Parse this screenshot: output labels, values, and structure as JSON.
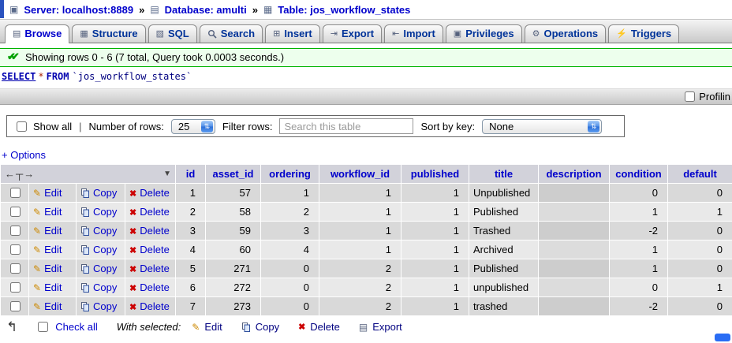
{
  "breadcrumb": {
    "server": "Server: localhost:8889",
    "database": "Database: amulti",
    "table": "Table: jos_workflow_states",
    "separator": "»"
  },
  "tabs": [
    {
      "label": "Browse",
      "icon": "browse-icon",
      "active": true
    },
    {
      "label": "Structure",
      "icon": "structure-icon",
      "active": false
    },
    {
      "label": "SQL",
      "icon": "sql-icon",
      "active": false
    },
    {
      "label": "Search",
      "icon": "search-icon",
      "active": false
    },
    {
      "label": "Insert",
      "icon": "insert-icon",
      "active": false
    },
    {
      "label": "Export",
      "icon": "export-icon",
      "active": false
    },
    {
      "label": "Import",
      "icon": "import-icon",
      "active": false
    },
    {
      "label": "Privileges",
      "icon": "privileges-icon",
      "active": false
    },
    {
      "label": "Operations",
      "icon": "operations-icon",
      "active": false
    },
    {
      "label": "Triggers",
      "icon": "triggers-icon",
      "active": false
    }
  ],
  "status_message": "Showing rows 0 - 6 (7 total, Query took 0.0003 seconds.)",
  "sql": {
    "keyword_select": "SELECT",
    "star": "*",
    "keyword_from": "FROM",
    "table_name": "`jos_workflow_states`"
  },
  "profiling_label": "Profilin",
  "controls": {
    "show_all_label": "Show all",
    "separator": "|",
    "number_of_rows_label": "Number of rows:",
    "number_of_rows_value": "25",
    "filter_label": "Filter rows:",
    "filter_placeholder": "Search this table",
    "sort_label": "Sort by key:",
    "sort_value": "None"
  },
  "options_label": "+ Options",
  "grid": {
    "column_headers": [
      "id",
      "asset_id",
      "ordering",
      "workflow_id",
      "published",
      "title",
      "description",
      "condition",
      "default"
    ],
    "row_actions": {
      "edit": "Edit",
      "copy": "Copy",
      "delete": "Delete"
    },
    "rows": [
      {
        "cells": [
          "1",
          "57",
          "1",
          "1",
          "1",
          "Unpublished",
          "",
          "0",
          "0"
        ]
      },
      {
        "cells": [
          "2",
          "58",
          "2",
          "1",
          "1",
          "Published",
          "",
          "1",
          "1"
        ]
      },
      {
        "cells": [
          "3",
          "59",
          "3",
          "1",
          "1",
          "Trashed",
          "",
          "-2",
          "0"
        ]
      },
      {
        "cells": [
          "4",
          "60",
          "4",
          "1",
          "1",
          "Archived",
          "",
          "1",
          "0"
        ]
      },
      {
        "cells": [
          "5",
          "271",
          "0",
          "2",
          "1",
          "Published",
          "",
          "1",
          "0"
        ]
      },
      {
        "cells": [
          "6",
          "272",
          "0",
          "2",
          "1",
          "unpublished",
          "",
          "0",
          "1"
        ]
      },
      {
        "cells": [
          "7",
          "273",
          "0",
          "2",
          "1",
          "trashed",
          "",
          "-2",
          "0"
        ]
      }
    ]
  },
  "footer": {
    "check_all_label": "Check all",
    "with_selected_label": "With selected:",
    "actions": [
      "Edit",
      "Copy",
      "Delete",
      "Export"
    ]
  },
  "icons": {
    "server-icon": "▣",
    "database-icon": "▤",
    "table-icon": "▦",
    "browse-icon": "▤",
    "structure-icon": "▦",
    "sql-icon": "▧",
    "insert-icon": "⊞",
    "export-icon": "⇥",
    "import-icon": "⇤",
    "privileges-icon": "▣",
    "operations-icon": "⚙",
    "triggers-icon": "⚡",
    "edit-icon": "✎",
    "delete-icon": "✖",
    "success-icon": "✔✔",
    "sort-desc-icon": "▼",
    "column-arrows-icon": "←┬→",
    "check-all-arrow-icon": "↰",
    "export-action-icon": "▤"
  },
  "colors": {
    "link_blue": "#0000cc",
    "success_green": "#00b400",
    "delete_red": "#cc0000",
    "pencil_orange": "#cc8800",
    "select_cap_blue": "#2b6fd8"
  }
}
